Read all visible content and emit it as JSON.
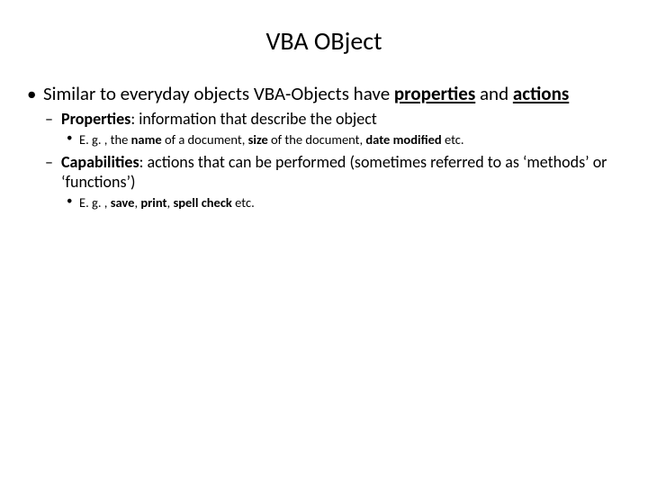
{
  "title": "VBA OBject",
  "l1": {
    "pre": "Similar to everyday objects VBA-Objects have ",
    "b1": "properties",
    "mid": " and ",
    "b2": "actions"
  },
  "prop": {
    "label": "Properties",
    "rest": ": information that describe the object",
    "eg_pre": "E. g. , the ",
    "eg_b1": "name",
    "eg_mid1": " of a document, ",
    "eg_b2": "size",
    "eg_mid2": " of the document, ",
    "eg_b3": "date modified ",
    "eg_post": "etc."
  },
  "cap": {
    "label": "Capabilities",
    "rest": ": actions that can be performed (sometimes referred to as ‘methods’ or ‘functions’)",
    "eg_pre": "E. g. , ",
    "eg_b1": "save",
    "eg_c1": ", ",
    "eg_b2": "print",
    "eg_c2": ", ",
    "eg_b3": "spell check ",
    "eg_post": "etc."
  }
}
